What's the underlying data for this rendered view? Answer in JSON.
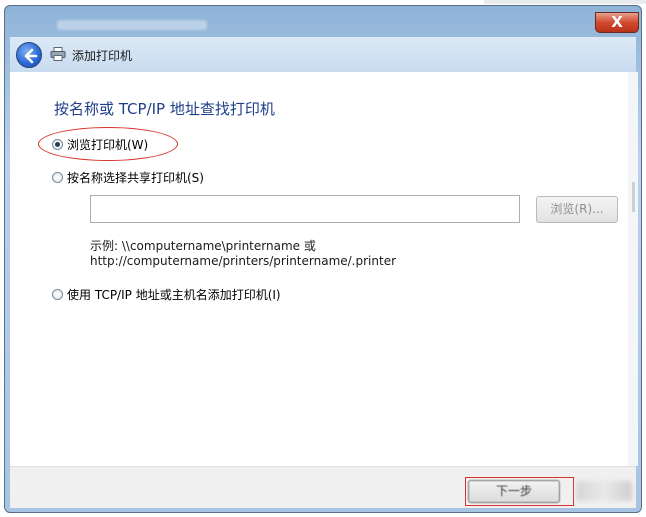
{
  "window": {
    "close_glyph": "X",
    "breadcrumb_title": "添加打印机"
  },
  "content": {
    "heading": "按名称或 TCP/IP 地址查找打印机",
    "options": [
      {
        "label": "浏览打印机(W)",
        "checked": true
      },
      {
        "label": "按名称选择共享打印机(S)",
        "checked": false
      },
      {
        "label": "使用 TCP/IP 地址或主机名添加打印机(I)",
        "checked": false
      }
    ],
    "share_path_value": "",
    "browse_button": "浏览(R)...",
    "example_line1": "示例: \\\\computername\\printername 或",
    "example_line2": "http://computername/printers/printername/.printer"
  },
  "footer": {
    "next_button": "下一步"
  },
  "colors": {
    "heading": "#1e3f8a",
    "annotation": "#d6332c"
  },
  "icons": {
    "back": "back-arrow-icon",
    "printer": "printer-icon",
    "close": "close-icon"
  }
}
